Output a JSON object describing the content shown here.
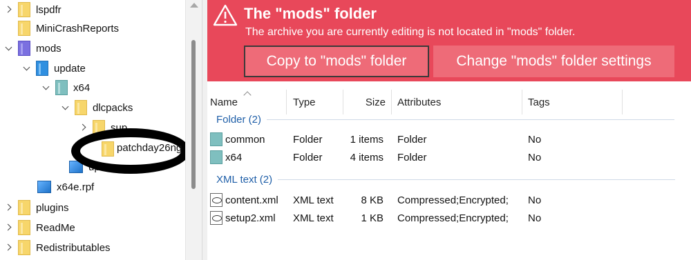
{
  "tree": {
    "items": [
      {
        "label": "lspdfr",
        "chevron": "right",
        "icon": "folder-icon"
      },
      {
        "label": "MiniCrashReports",
        "chevron": "",
        "icon": "folder-icon"
      },
      {
        "label": "mods",
        "chevron": "down",
        "icon": "mods-folder-icon"
      },
      {
        "label": "update",
        "chevron": "down",
        "icon": "update-folder-icon"
      },
      {
        "label": "x64",
        "chevron": "down",
        "icon": "archive-folder-icon"
      },
      {
        "label": "dlcpacks",
        "chevron": "down",
        "icon": "folder-icon"
      },
      {
        "label": "sup",
        "chevron": "right",
        "icon": "folder-icon"
      },
      {
        "label": "patchday26ng",
        "chevron": "",
        "icon": "folder-icon"
      },
      {
        "label": "update.rpf",
        "chevron": "",
        "icon": "rpf-file-icon"
      },
      {
        "label": "x64e.rpf",
        "chevron": "",
        "icon": "rpf-file-icon"
      },
      {
        "label": "plugins",
        "chevron": "right",
        "icon": "folder-icon"
      },
      {
        "label": "ReadMe",
        "chevron": "right",
        "icon": "folder-icon"
      },
      {
        "label": "Redistributables",
        "chevron": "right",
        "icon": "folder-icon"
      }
    ]
  },
  "banner": {
    "title": "The \"mods\" folder",
    "message": "The archive you are currently editing is not located in \"mods\" folder.",
    "copy_button": "Copy to \"mods\" folder",
    "settings_button": "Change \"mods\" folder settings",
    "color": "#e8485a"
  },
  "list": {
    "columns": [
      "Name",
      "Type",
      "Size",
      "Attributes",
      "Tags"
    ],
    "groups": [
      {
        "label": "Folder (2)",
        "rows": [
          {
            "name": "common",
            "type": "Folder",
            "size": "1 items",
            "attributes": "Folder",
            "tags": "No",
            "icon": "folder-icon"
          },
          {
            "name": "x64",
            "type": "Folder",
            "size": "4 items",
            "attributes": "Folder",
            "tags": "No",
            "icon": "folder-icon"
          }
        ]
      },
      {
        "label": "XML text (2)",
        "rows": [
          {
            "name": "content.xml",
            "type": "XML text",
            "size": "8 KB",
            "attributes": "Compressed;Encrypted;",
            "tags": "No",
            "icon": "xml-file-icon"
          },
          {
            "name": "setup2.xml",
            "type": "XML text",
            "size": "1 KB",
            "attributes": "Compressed;Encrypted;",
            "tags": "No",
            "icon": "xml-file-icon"
          }
        ]
      }
    ]
  }
}
